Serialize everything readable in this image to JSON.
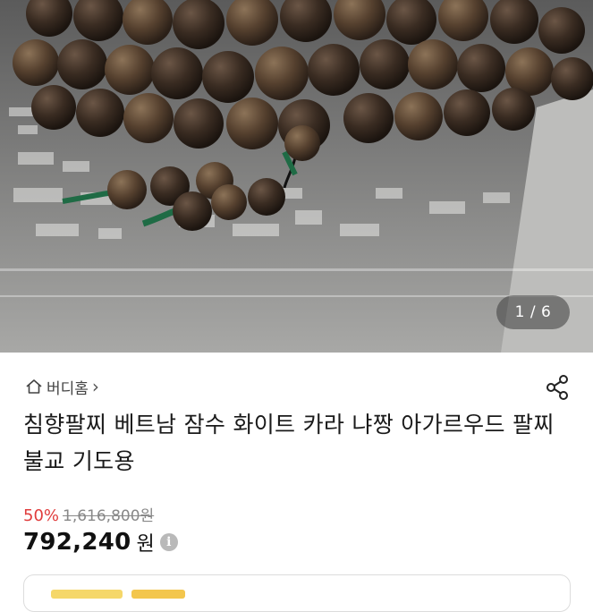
{
  "image": {
    "counter_text": "1 / 6"
  },
  "store": {
    "name": "버디홈",
    "chevron": "›"
  },
  "product": {
    "title": "침향팔찌 베트남 잠수 화이트 카라 냐짱 아가르우드 팔찌 불교 기도용"
  },
  "pricing": {
    "discount_rate": "50%",
    "original_price": "1,616,800원",
    "sale_price": "792,240",
    "currency": "원"
  },
  "icons": {
    "home": "home-icon",
    "share": "share-icon",
    "info": "info-icon"
  },
  "colors": {
    "discount": "#e03c3c",
    "bead": "#3a2c22",
    "tassel": "#1f6b45"
  }
}
